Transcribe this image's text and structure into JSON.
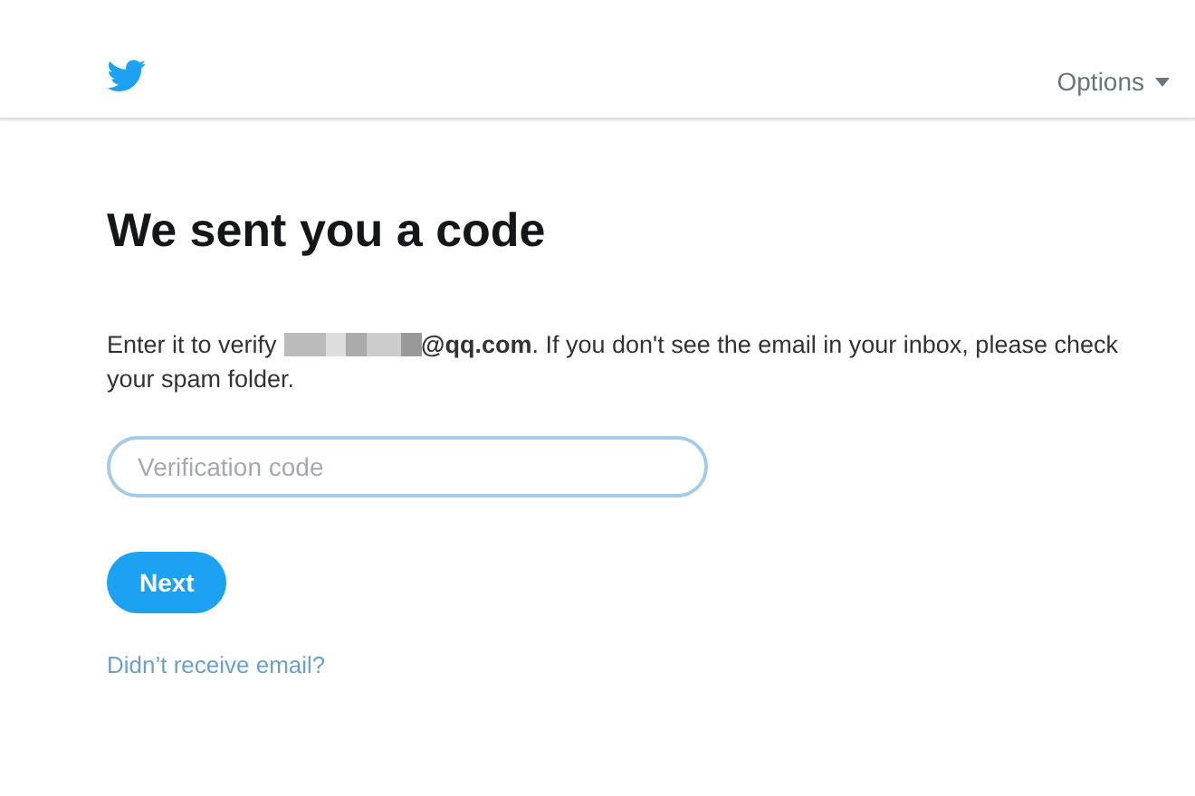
{
  "header": {
    "options_label": "Options"
  },
  "heading": "We sent you a code",
  "message": {
    "intro": "Enter it to verify",
    "email_redacted": true,
    "rest": "**@qq.com**. If you don't see the email in your inbox, please check your spam folder."
  },
  "code_field": {
    "placeholder": "Verification code"
  },
  "next_button": "Next",
  "resend_link": "Didn’t receive email?"
}
